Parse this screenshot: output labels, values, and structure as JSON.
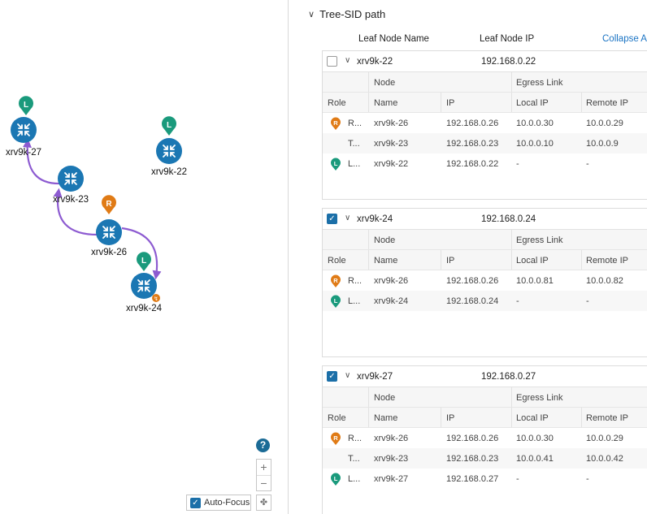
{
  "panel": {
    "title": "Tree-SID path",
    "columns": {
      "leaf_name": "Leaf Node Name",
      "leaf_ip": "Leaf Node IP",
      "collapse": "Collapse A"
    }
  },
  "table_labels": {
    "node_group": "Node",
    "egress_group": "Egress Link",
    "role": "Role",
    "name": "Name",
    "ip": "IP",
    "local_ip": "Local IP",
    "remote_ip": "Remote IP"
  },
  "leaves": [
    {
      "name": "xrv9k-22",
      "ip": "192.168.0.22",
      "checked": false,
      "rows": [
        {
          "badge": "R",
          "role": "R...",
          "name": "xrv9k-26",
          "ip": "192.168.0.26",
          "local_ip": "10.0.0.30",
          "remote_ip": "10.0.0.29"
        },
        {
          "badge": "",
          "role": "T...",
          "name": "xrv9k-23",
          "ip": "192.168.0.23",
          "local_ip": "10.0.0.10",
          "remote_ip": "10.0.0.9"
        },
        {
          "badge": "L",
          "role": "L...",
          "name": "xrv9k-22",
          "ip": "192.168.0.22",
          "local_ip": "-",
          "remote_ip": "-"
        }
      ]
    },
    {
      "name": "xrv9k-24",
      "ip": "192.168.0.24",
      "checked": true,
      "rows": [
        {
          "badge": "R",
          "role": "R...",
          "name": "xrv9k-26",
          "ip": "192.168.0.26",
          "local_ip": "10.0.0.81",
          "remote_ip": "10.0.0.82"
        },
        {
          "badge": "L",
          "role": "L...",
          "name": "xrv9k-24",
          "ip": "192.168.0.24",
          "local_ip": "-",
          "remote_ip": "-"
        }
      ]
    },
    {
      "name": "xrv9k-27",
      "ip": "192.168.0.27",
      "checked": true,
      "rows": [
        {
          "badge": "R",
          "role": "R...",
          "name": "xrv9k-26",
          "ip": "192.168.0.26",
          "local_ip": "10.0.0.30",
          "remote_ip": "10.0.0.29"
        },
        {
          "badge": "",
          "role": "T...",
          "name": "xrv9k-23",
          "ip": "192.168.0.23",
          "local_ip": "10.0.0.41",
          "remote_ip": "10.0.0.42"
        },
        {
          "badge": "L",
          "role": "L...",
          "name": "xrv9k-27",
          "ip": "192.168.0.27",
          "local_ip": "-",
          "remote_ip": "-"
        }
      ]
    }
  ],
  "topology": {
    "nodes": [
      {
        "name": "xrv9k-27",
        "marker": "L"
      },
      {
        "name": "xrv9k-22",
        "marker": "L"
      },
      {
        "name": "xrv9k-23",
        "marker": ""
      },
      {
        "name": "xrv9k-26",
        "marker": "R"
      },
      {
        "name": "xrv9k-24",
        "marker": "L"
      }
    ],
    "marker_colors": {
      "L": "#1a9a7c",
      "R": "#e07b16"
    },
    "router_color": "#1b77b3",
    "link_color": "#8d5bd1"
  },
  "controls": {
    "help": "?",
    "zoom_in": "+",
    "zoom_out": "−",
    "fit": "✤",
    "autofocus_label": "Auto-Focus",
    "autofocus_checked": true
  }
}
